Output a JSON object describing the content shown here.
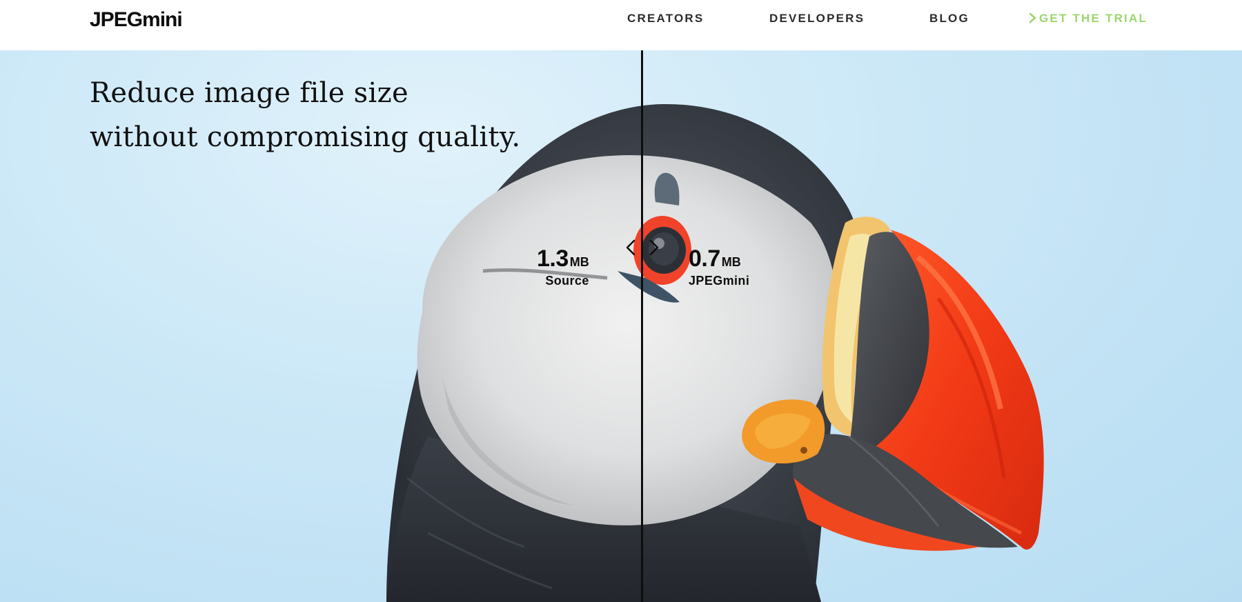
{
  "header": {
    "logo": "JPEGmini",
    "nav": [
      {
        "label": "CREATORS"
      },
      {
        "label": "DEVELOPERS"
      },
      {
        "label": "BLOG"
      },
      {
        "label": "GET THE TRIAL"
      }
    ]
  },
  "hero": {
    "headline_line1": "Reduce image file size",
    "headline_line2": "without compromising quality.",
    "source": {
      "value": "1.3",
      "unit": "MB",
      "caption": "Source"
    },
    "optimized": {
      "value": "0.7",
      "unit": "MB",
      "caption": "JPEGmini"
    },
    "icons": {
      "trial": "chevron-right-icon",
      "handle_left": "chevron-left-icon",
      "handle_right": "chevron-right-icon"
    }
  },
  "colors": {
    "accent_trial": "#9bd66d",
    "sky": "#c6e5f6",
    "beak_orange": "#f2421c",
    "text": "#111111"
  }
}
